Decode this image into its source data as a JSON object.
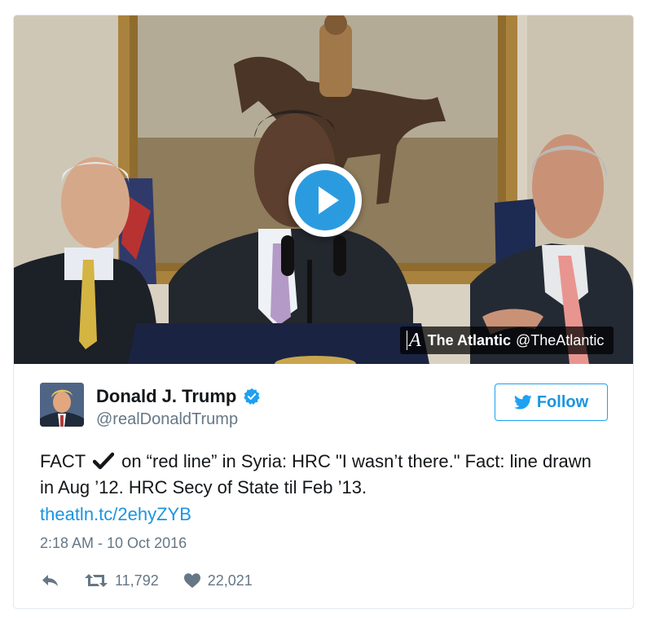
{
  "media": {
    "source_name": "The Atlantic",
    "source_handle": "@TheAtlantic",
    "logo_glyph": "A"
  },
  "author": {
    "name": "Donald J. Trump",
    "screen_name": "@realDonaldTrump",
    "verified_icon": "verified-badge-icon"
  },
  "follow_button": {
    "label": "Follow"
  },
  "tweet": {
    "text_part1": "FACT",
    "text_part2": "on “red line” in Syria: HRC \"I wasn’t there.\" Fact: line drawn in Aug ’12. HRC Secy of State til Feb ’13.",
    "link": "theatln.tc/2ehyZYB",
    "timestamp": "2:18 AM - 10 Oct 2016"
  },
  "actions": {
    "retweets": "11,792",
    "likes": "22,021"
  },
  "colors": {
    "accent": "#1b95e0",
    "text": "#14171a",
    "muted": "#657786",
    "border": "#e1e8ed"
  }
}
